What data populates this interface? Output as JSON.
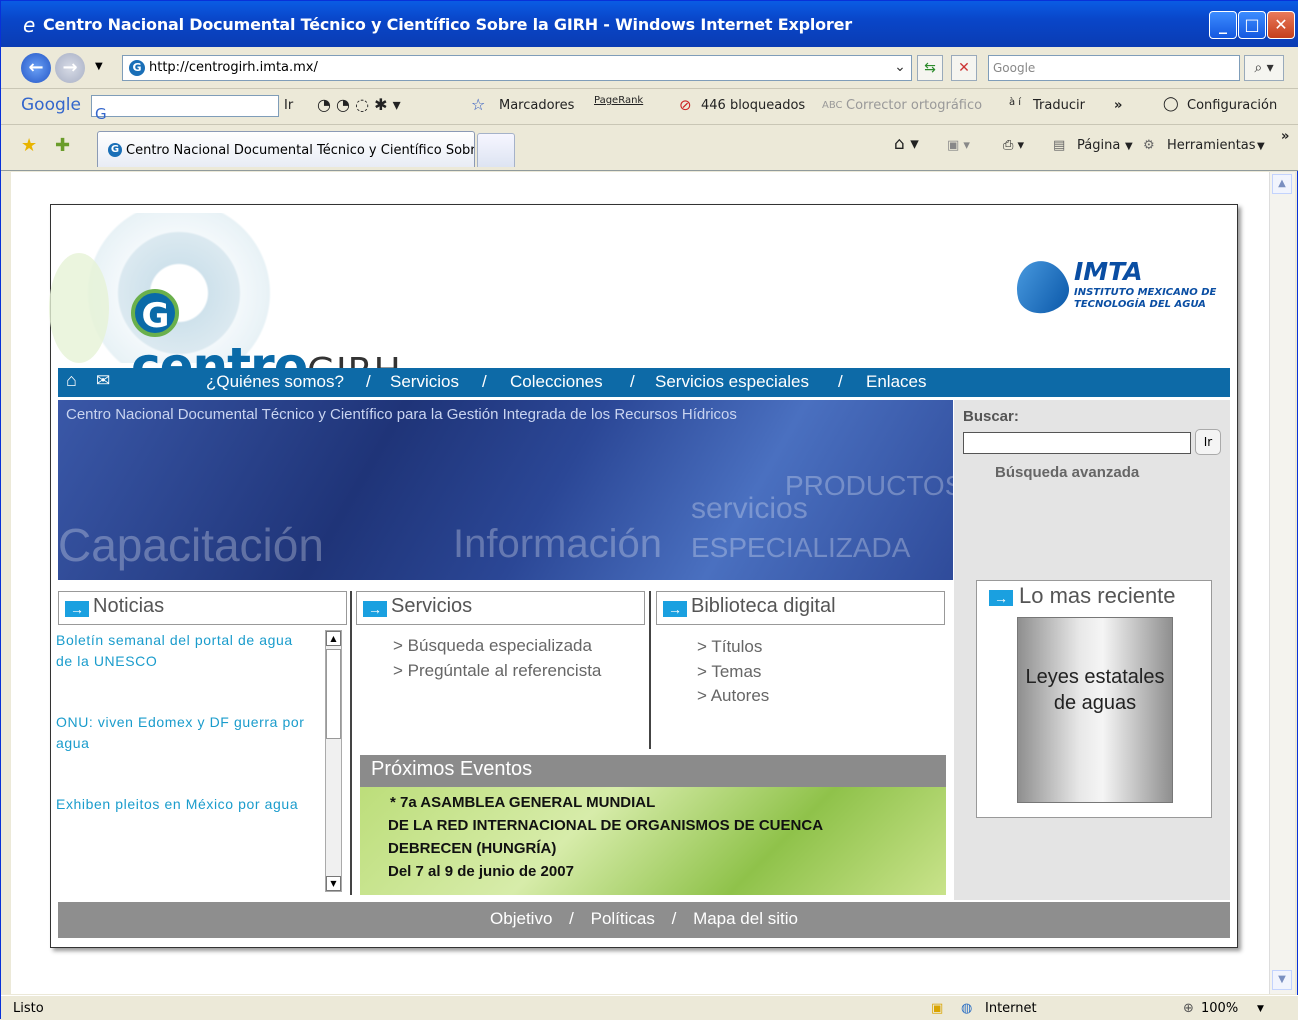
{
  "window": {
    "title": "Centro Nacional Documental Técnico y Científico Sobre la GIRH - Windows Internet Explorer"
  },
  "address": {
    "url": "http://centrogirh.imta.mx/",
    "search_placeholder": "Google"
  },
  "google_bar": {
    "logo": "Google",
    "letter": "G",
    "go": "Ir",
    "bookmarks": "Marcadores",
    "pagerank": "PageRank",
    "blocked": "446 bloqueados",
    "spell": "Corrector ortográfico",
    "translate": "Traducir",
    "more": "»",
    "config": "Configuración"
  },
  "tab": {
    "label": "Centro Nacional Documental Técnico y Científico Sobr..."
  },
  "tools": {
    "page": "Página",
    "tools": "Herramientas",
    "more": "»"
  },
  "site": {
    "brand_prefix": "centro",
    "brand_suffix": "GIRH",
    "imta_name": "IMTA",
    "imta_sub": "INSTITUTO MEXICANO DE TECNOLOGÍA DEL AGUA",
    "nav": [
      "¿Quiénes somos?",
      "/",
      "Servicios",
      "/",
      "Colecciones",
      "/",
      "Servicios especiales",
      "/",
      "Enlaces"
    ],
    "banner_subtitle": "Centro Nacional Documental Técnico y Científico para la Gestión Integrada de los Recursos Hídricos",
    "banner_words": {
      "productos": "PRODUCTOS",
      "servicios": "servicios",
      "capacitacion": "Capacitación",
      "informacion": "Información",
      "especializada": "ESPECIALIZADA"
    },
    "search": {
      "label": "Buscar:",
      "button": "Ir",
      "advanced": "Búsqueda avanzada"
    },
    "noticias": {
      "title": "Noticias",
      "items": [
        "Boletín semanal del portal de agua de la UNESCO",
        "ONU: viven Edomex y DF guerra por agua",
        "Exhiben pleitos en México por agua"
      ]
    },
    "servicios": {
      "title": "Servicios",
      "links": [
        "> Búsqueda especializada",
        "> Pregúntale al referencista"
      ]
    },
    "biblioteca": {
      "title": "Biblioteca digital",
      "links": [
        "> Títulos",
        "> Temas",
        "> Autores"
      ]
    },
    "eventos": {
      "title": "Próximos Eventos",
      "lines": [
        "* 7a ASAMBLEA GENERAL MUNDIAL",
        "DE LA RED INTERNACIONAL DE ORGANISMOS DE CUENCA",
        "DEBRECEN (HUNGRÍA)",
        "Del 7 al 9 de junio de 2007"
      ]
    },
    "reciente": {
      "title": "Lo mas reciente",
      "card": "Leyes estatales de aguas"
    },
    "footer": [
      "Objetivo",
      "/",
      "Políticas",
      "/",
      "Mapa del sitio"
    ]
  },
  "status": {
    "text": "Listo",
    "zone": "Internet",
    "zoom": "100%"
  }
}
